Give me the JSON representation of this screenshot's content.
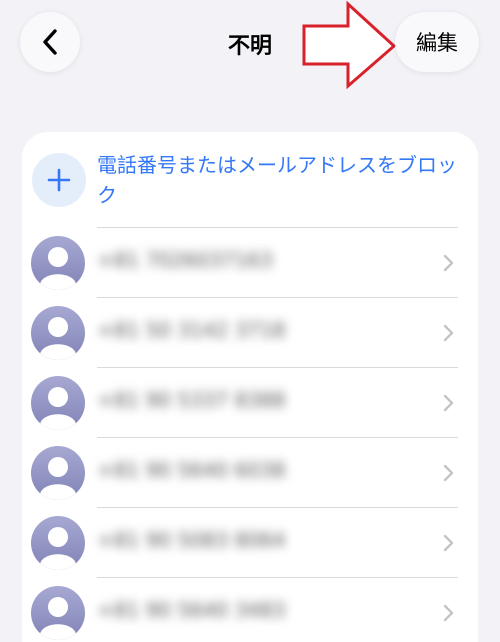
{
  "nav": {
    "back_icon": "chevron-left-icon",
    "title": "不明",
    "edit_label": "編集"
  },
  "annotation": {
    "arrow_color": "#d9212b",
    "arrow_direction": "right"
  },
  "add_block": {
    "icon": "plus-icon",
    "label": "電話番号またはメールアドレスをブロック",
    "accent_color": "#3478f6"
  },
  "contacts": [
    {
      "number": "+81 7026037163"
    },
    {
      "number": "+81 50 3142 3718"
    },
    {
      "number": "+81 90 5337 8388"
    },
    {
      "number": "+81 90 5640 6038"
    },
    {
      "number": "+81 90 5083 8064"
    },
    {
      "number": "+81 90 5640 3483"
    }
  ]
}
